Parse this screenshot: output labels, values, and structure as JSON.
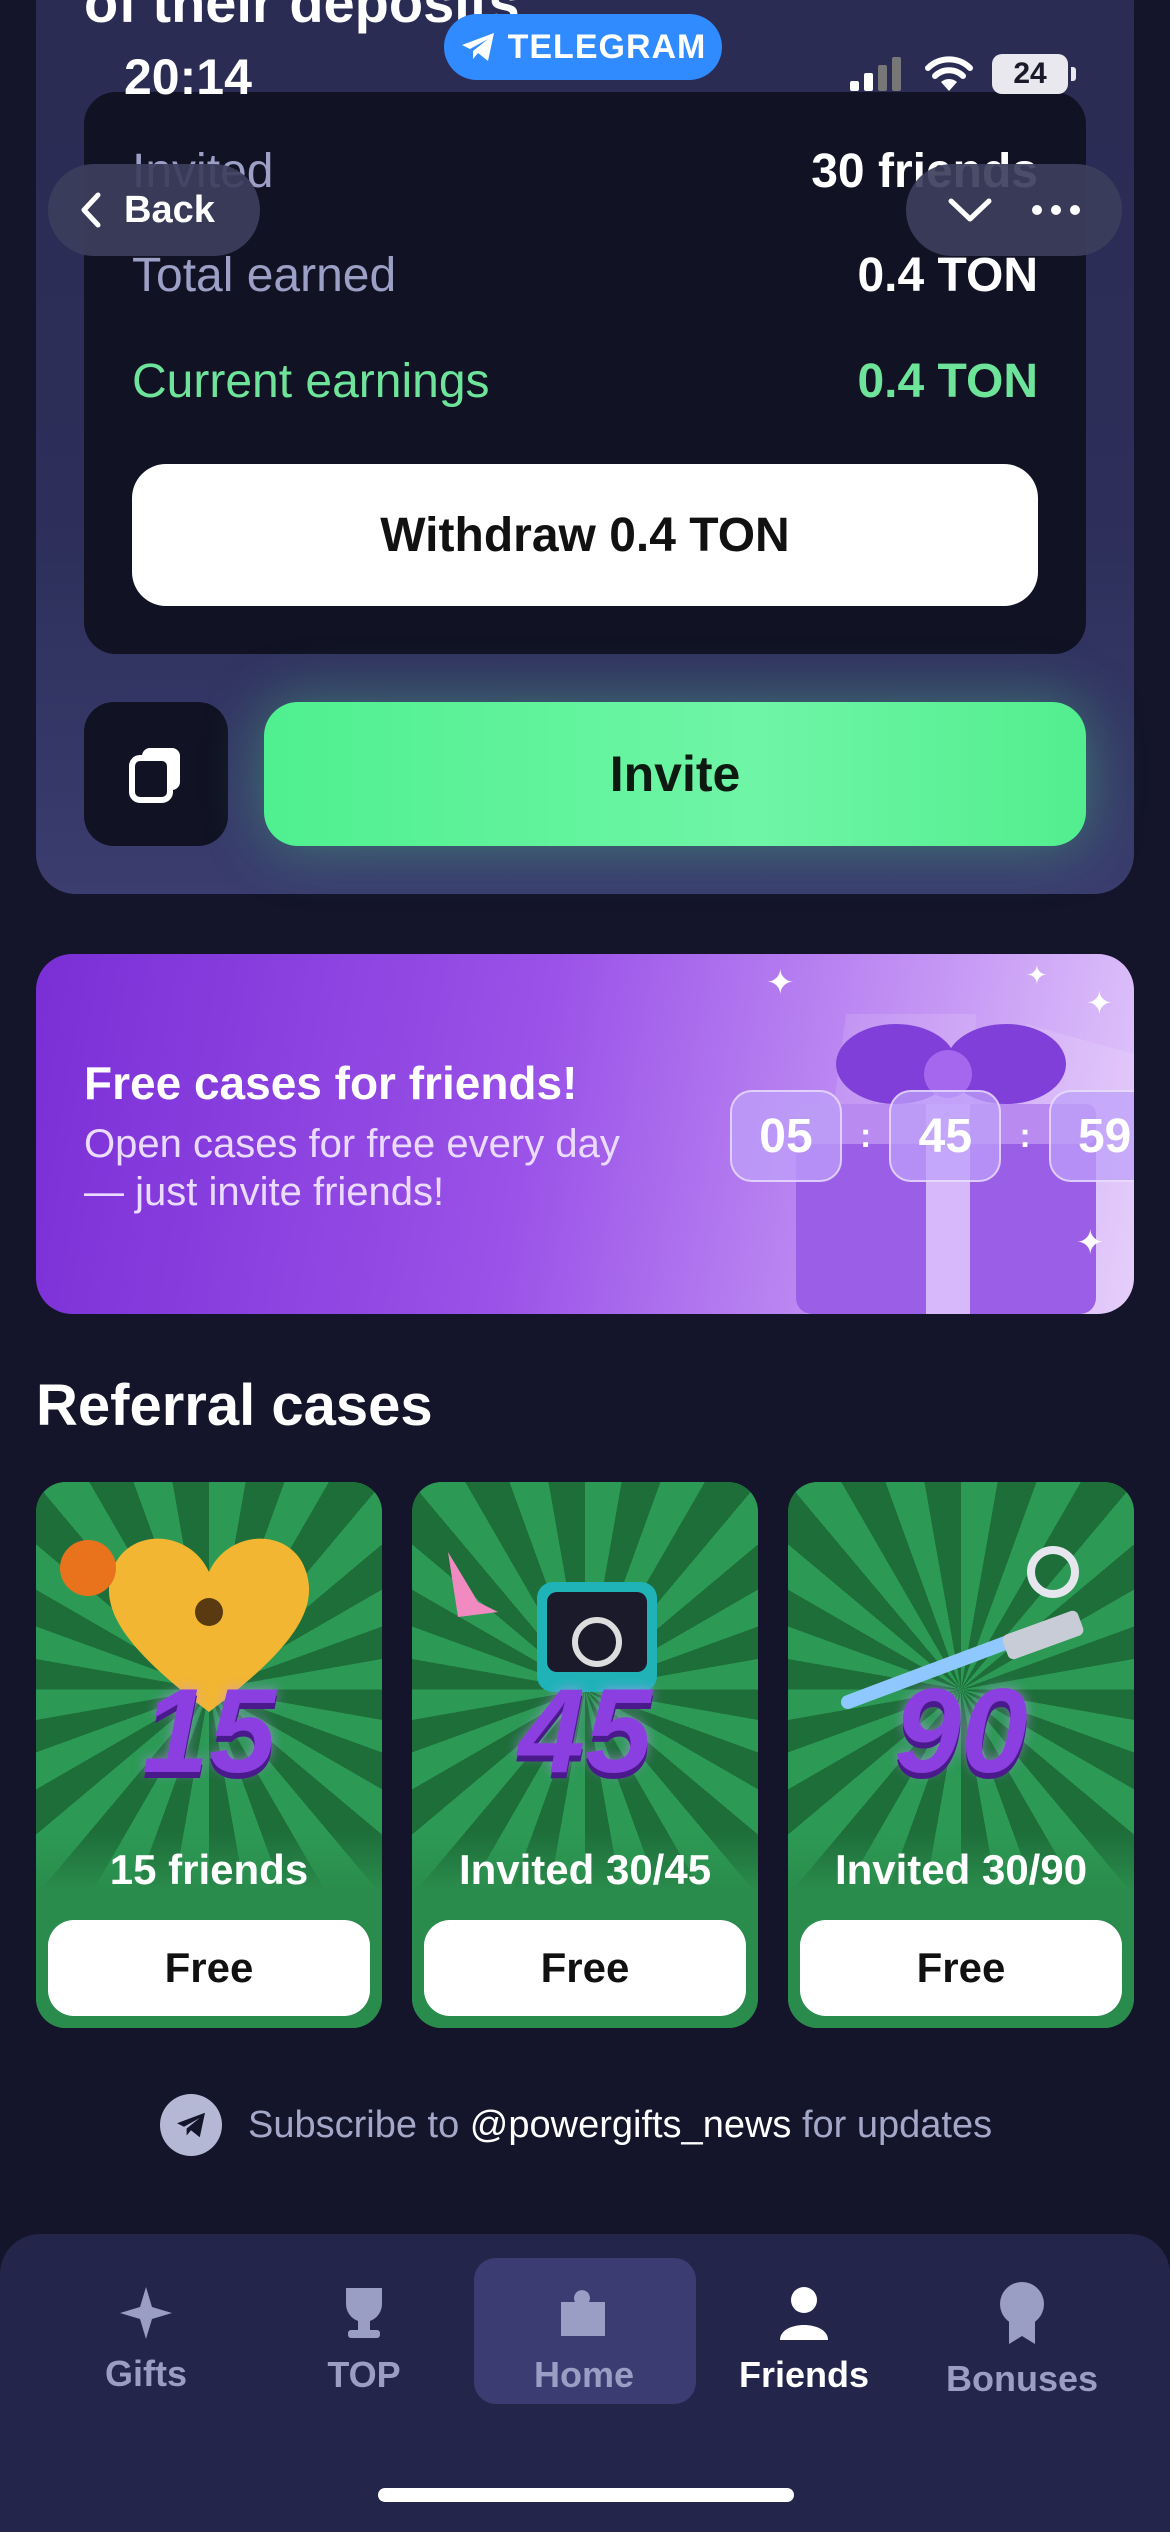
{
  "status_bar": {
    "time": "20:14",
    "battery": "24"
  },
  "telegram": {
    "badge": "TELEGRAM",
    "back_label": "Back"
  },
  "referral": {
    "heading": "of their deposits",
    "stats": [
      {
        "label": "Invited",
        "value": "30 friends"
      },
      {
        "label": "Total earned",
        "value": "0.4 TON"
      },
      {
        "label": "Current earnings",
        "value": "0.4 TON"
      }
    ],
    "withdraw_label": "Withdraw 0.4 TON",
    "invite_label": "Invite"
  },
  "promo": {
    "title": "Free cases for friends!",
    "subtitle": "Open cases for free every day — just invite friends!",
    "timer": {
      "hours": "05",
      "minutes": "45",
      "seconds": "59"
    }
  },
  "section_title": "Referral cases",
  "cases": [
    {
      "number": "15",
      "label": "15 friends",
      "button": "Free"
    },
    {
      "number": "45",
      "label": "Invited 30/45",
      "button": "Free"
    },
    {
      "number": "90",
      "label": "Invited 30/90",
      "button": "Free"
    }
  ],
  "subscribe": {
    "prefix": "Subscribe to ",
    "handle": "@powergifts_news",
    "suffix": " for updates"
  },
  "tabs": [
    {
      "label": "Gifts",
      "icon": "sparkle-icon"
    },
    {
      "label": "TOP",
      "icon": "trophy-icon"
    },
    {
      "label": "Home",
      "icon": "puzzle-icon"
    },
    {
      "label": "Friends",
      "icon": "person-icon"
    },
    {
      "label": "Bonuses",
      "icon": "medal-icon"
    }
  ],
  "colors": {
    "background": "#14142a",
    "accent_green": "#4ff08f",
    "telegram_blue": "#2f8bff",
    "promo_purple": "#7a2fd6"
  }
}
